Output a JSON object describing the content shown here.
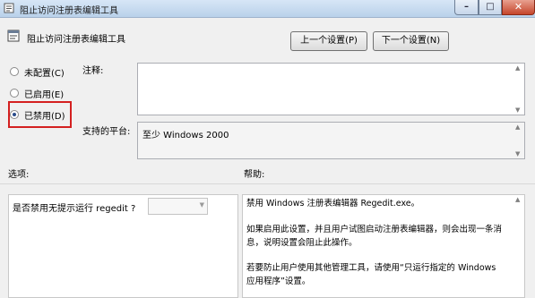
{
  "window": {
    "title": "阻止访问注册表编辑工具"
  },
  "header": {
    "title": "阻止访问注册表编辑工具"
  },
  "nav": {
    "prev_label": "上一个设置(P)",
    "next_label": "下一个设置(N)"
  },
  "state": {
    "options": [
      {
        "label": "未配置(C)",
        "checked": false
      },
      {
        "label": "已启用(E)",
        "checked": false
      },
      {
        "label": "已禁用(D)",
        "checked": true
      }
    ]
  },
  "comment": {
    "label": "注释:",
    "value": ""
  },
  "platform": {
    "label": "支持的平台:",
    "value": "至少 Windows 2000"
  },
  "options_section": {
    "label": "选项:",
    "prompt": "是否禁用无提示运行 regedit ?",
    "dropdown_value": ""
  },
  "help_section": {
    "label": "帮助:",
    "paragraphs": [
      "禁用 Windows 注册表编辑器 Regedit.exe。",
      "如果启用此设置，并且用户试图启动注册表编辑器，则会出现一条消息，说明设置会阻止此操作。",
      "若要防止用户使用其他管理工具，请使用“只运行指定的 Windows 应用程序”设置。"
    ]
  },
  "colors": {
    "highlight": "#d42020",
    "titlebar": "#c9dcf0",
    "close": "#c5452b"
  }
}
